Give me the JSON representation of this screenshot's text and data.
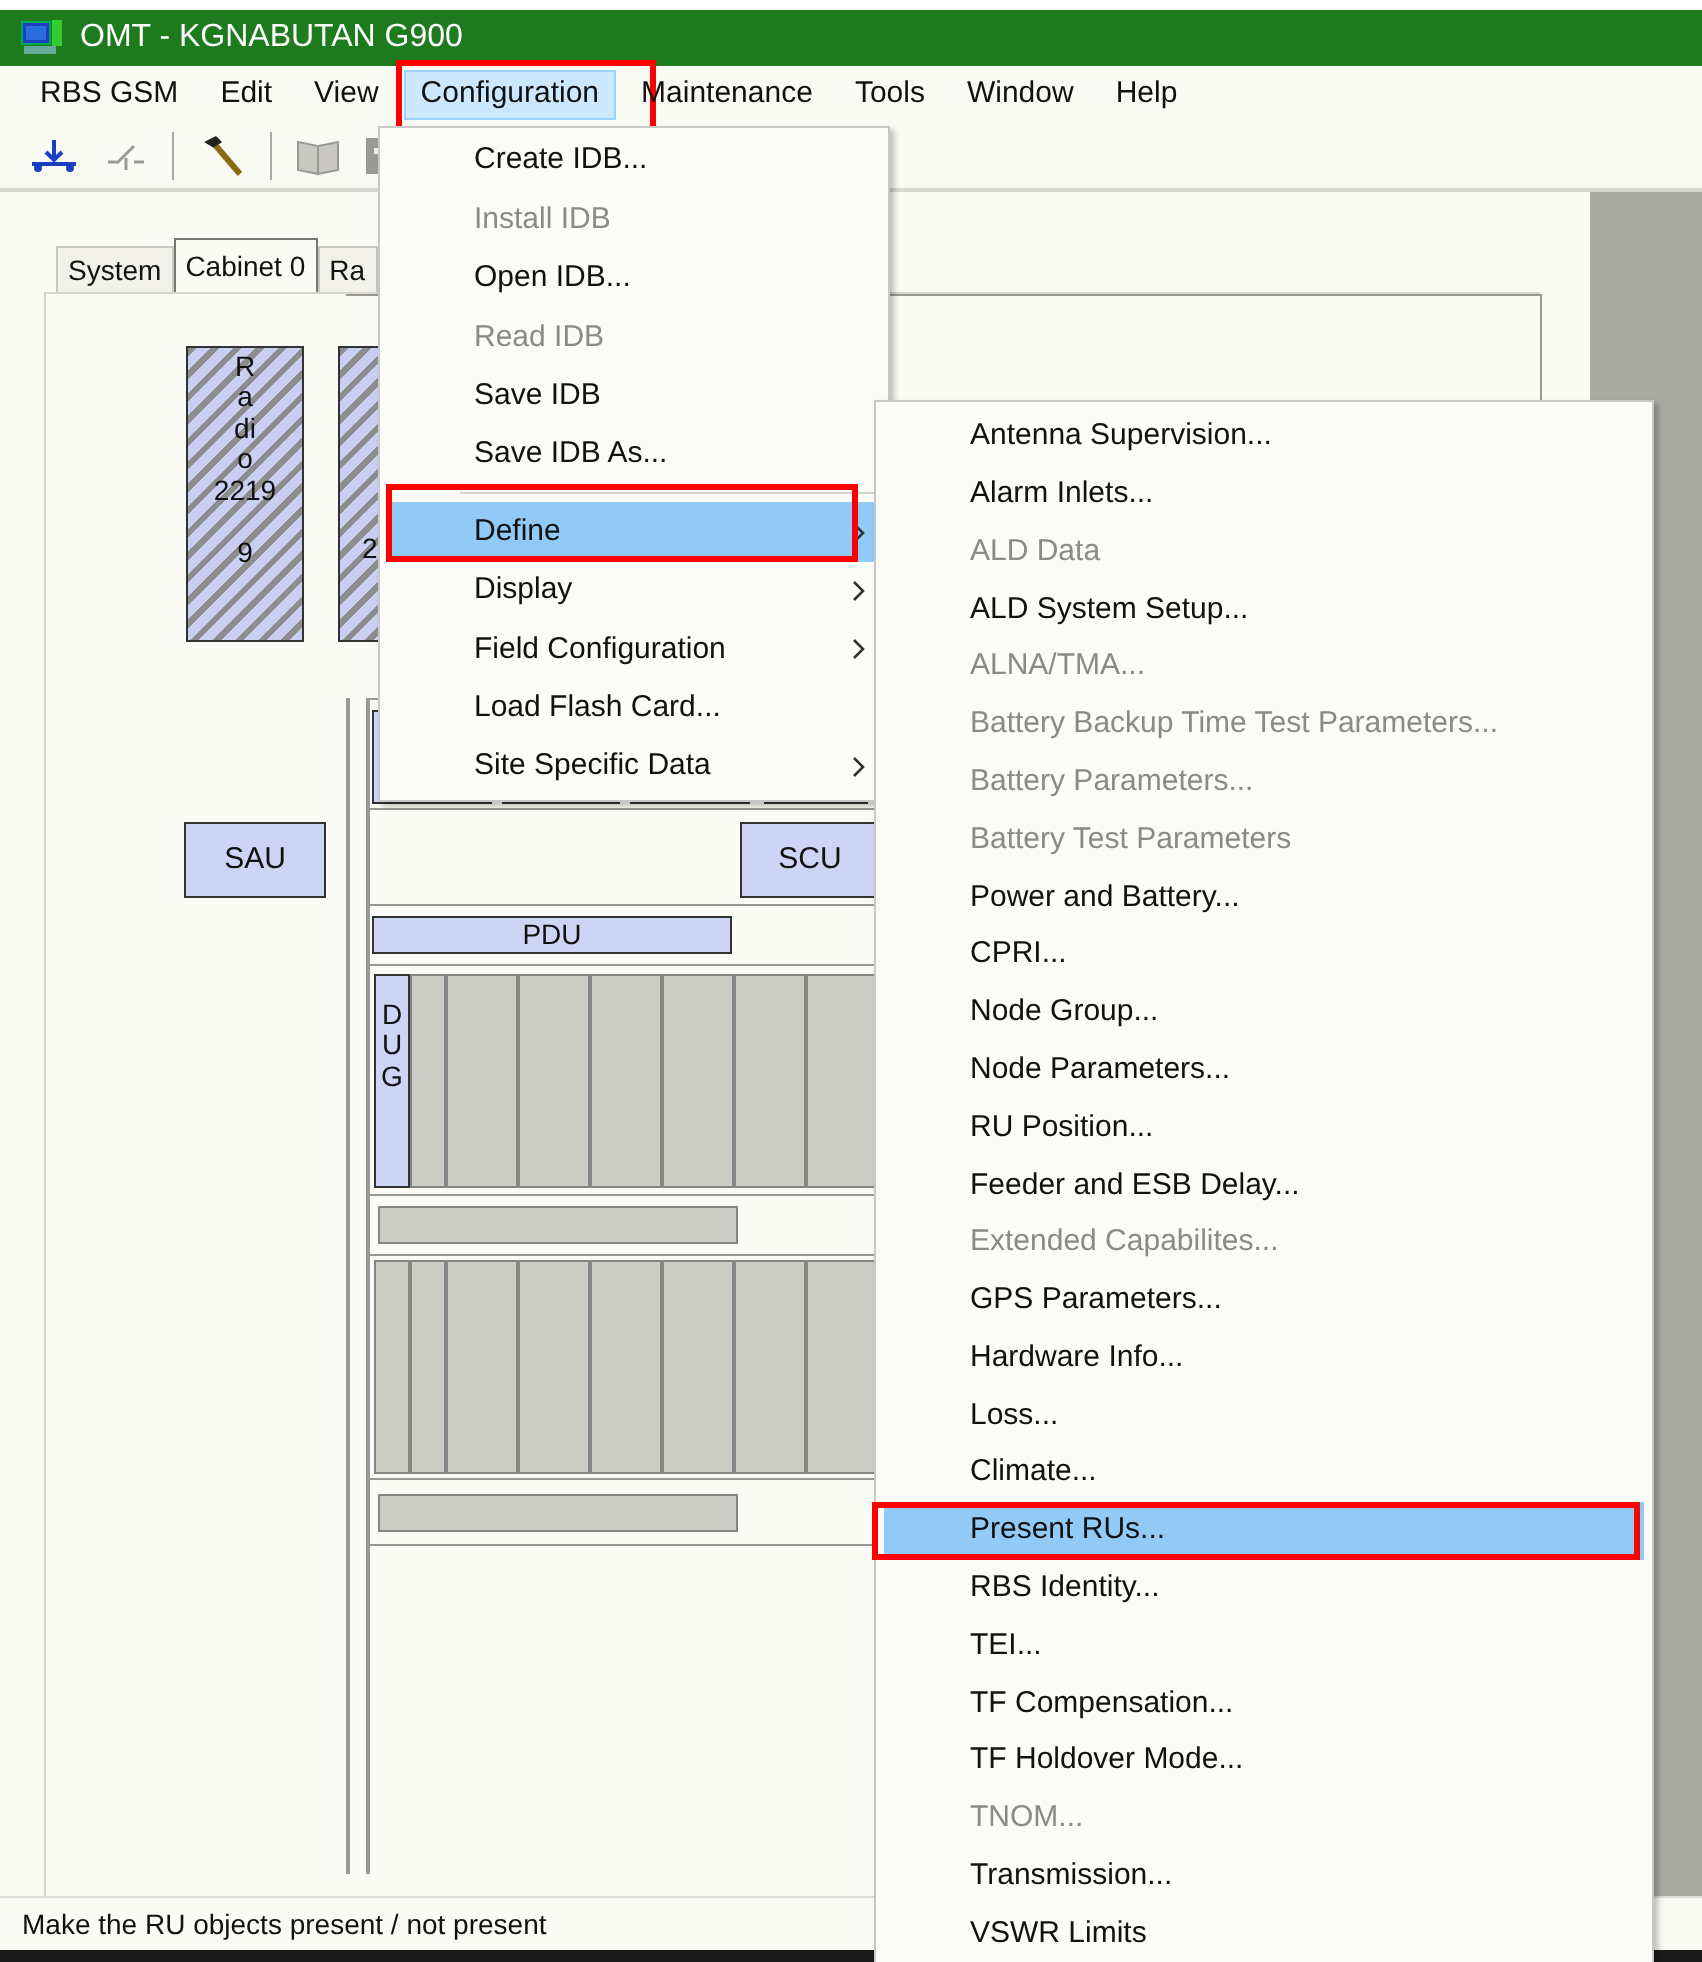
{
  "window": {
    "title": "OMT - KGNABUTAN G900"
  },
  "menubar": [
    {
      "label": "RBS GSM",
      "selected": false,
      "highlighted": false
    },
    {
      "label": "Edit",
      "selected": false,
      "highlighted": false
    },
    {
      "label": "View",
      "selected": false,
      "highlighted": false
    },
    {
      "label": "Configuration",
      "selected": true,
      "highlighted": true
    },
    {
      "label": "Maintenance",
      "selected": false,
      "highlighted": false
    },
    {
      "label": "Tools",
      "selected": false,
      "highlighted": false
    },
    {
      "label": "Window",
      "selected": false,
      "highlighted": false
    },
    {
      "label": "Help",
      "selected": false,
      "highlighted": false
    }
  ],
  "configuration_menu": {
    "items": [
      {
        "kind": "item",
        "label": "Create IDB...",
        "disabled": false,
        "selected": false,
        "highlighted": false,
        "submenu": false
      },
      {
        "kind": "item",
        "label": "Install IDB",
        "disabled": true,
        "selected": false,
        "highlighted": false,
        "submenu": false
      },
      {
        "kind": "item",
        "label": "Open IDB...",
        "disabled": false,
        "selected": false,
        "highlighted": false,
        "submenu": false
      },
      {
        "kind": "item",
        "label": "Read IDB",
        "disabled": true,
        "selected": false,
        "highlighted": false,
        "submenu": false
      },
      {
        "kind": "item",
        "label": "Save IDB",
        "disabled": false,
        "selected": false,
        "highlighted": false,
        "submenu": false
      },
      {
        "kind": "item",
        "label": "Save IDB As...",
        "disabled": false,
        "selected": false,
        "highlighted": false,
        "submenu": false
      },
      {
        "kind": "separator"
      },
      {
        "kind": "item",
        "label": "Define",
        "disabled": false,
        "selected": true,
        "highlighted": true,
        "submenu": true
      },
      {
        "kind": "item",
        "label": "Display",
        "disabled": false,
        "selected": false,
        "highlighted": false,
        "submenu": true
      },
      {
        "kind": "item",
        "label": "Field Configuration",
        "disabled": false,
        "selected": false,
        "highlighted": false,
        "submenu": true
      },
      {
        "kind": "item",
        "label": "Load Flash Card...",
        "disabled": false,
        "selected": false,
        "highlighted": false,
        "submenu": false
      },
      {
        "kind": "item",
        "label": "Site Specific Data",
        "disabled": false,
        "selected": false,
        "highlighted": false,
        "submenu": true
      }
    ]
  },
  "define_submenu": {
    "items": [
      {
        "label": "Antenna Supervision...",
        "disabled": false,
        "selected": false,
        "highlighted": false
      },
      {
        "label": "Alarm Inlets...",
        "disabled": false,
        "selected": false,
        "highlighted": false
      },
      {
        "label": "ALD Data",
        "disabled": true,
        "selected": false,
        "highlighted": false
      },
      {
        "label": "ALD System Setup...",
        "disabled": false,
        "selected": false,
        "highlighted": false
      },
      {
        "label": "ALNA/TMA...",
        "disabled": true,
        "selected": false,
        "highlighted": false
      },
      {
        "label": "Battery Backup Time Test Parameters...",
        "disabled": true,
        "selected": false,
        "highlighted": false
      },
      {
        "label": "Battery Parameters...",
        "disabled": true,
        "selected": false,
        "highlighted": false
      },
      {
        "label": "Battery Test Parameters",
        "disabled": true,
        "selected": false,
        "highlighted": false
      },
      {
        "label": "Power and Battery...",
        "disabled": false,
        "selected": false,
        "highlighted": false
      },
      {
        "label": "CPRI...",
        "disabled": false,
        "selected": false,
        "highlighted": false
      },
      {
        "label": "Node Group...",
        "disabled": false,
        "selected": false,
        "highlighted": false
      },
      {
        "label": "Node Parameters...",
        "disabled": false,
        "selected": false,
        "highlighted": false
      },
      {
        "label": "RU Position...",
        "disabled": false,
        "selected": false,
        "highlighted": false
      },
      {
        "label": "Feeder and ESB Delay...",
        "disabled": false,
        "selected": false,
        "highlighted": false
      },
      {
        "label": "Extended Capabilites...",
        "disabled": true,
        "selected": false,
        "highlighted": false
      },
      {
        "label": "GPS Parameters...",
        "disabled": false,
        "selected": false,
        "highlighted": false
      },
      {
        "label": "Hardware Info...",
        "disabled": false,
        "selected": false,
        "highlighted": false
      },
      {
        "label": "Loss...",
        "disabled": false,
        "selected": false,
        "highlighted": false
      },
      {
        "label": "Climate...",
        "disabled": false,
        "selected": false,
        "highlighted": false
      },
      {
        "label": "Present RUs...",
        "disabled": false,
        "selected": true,
        "highlighted": true
      },
      {
        "label": "RBS Identity...",
        "disabled": false,
        "selected": false,
        "highlighted": false
      },
      {
        "label": "TEI...",
        "disabled": false,
        "selected": false,
        "highlighted": false
      },
      {
        "label": "TF Compensation...",
        "disabled": false,
        "selected": false,
        "highlighted": false
      },
      {
        "label": "TF Holdover Mode...",
        "disabled": false,
        "selected": false,
        "highlighted": false
      },
      {
        "label": "TNOM...",
        "disabled": true,
        "selected": false,
        "highlighted": false
      },
      {
        "label": "Transmission...",
        "disabled": false,
        "selected": false,
        "highlighted": false
      },
      {
        "label": "VSWR Limits",
        "disabled": false,
        "selected": false,
        "highlighted": false
      }
    ]
  },
  "tabs": [
    {
      "label": "System",
      "selected": false
    },
    {
      "label": "Cabinet 0",
      "selected": true
    },
    {
      "label": "Ra",
      "selected": false
    }
  ],
  "cabinet": {
    "radios": [
      {
        "label": "Radio",
        "model": "2219",
        "number": "9"
      },
      {
        "model": "2"
      }
    ],
    "sau": "SAU",
    "scu": "SCU",
    "pdu": "PDU",
    "dug": "DUG"
  },
  "status_bar": {
    "text": "Make the RU objects present / not present"
  }
}
